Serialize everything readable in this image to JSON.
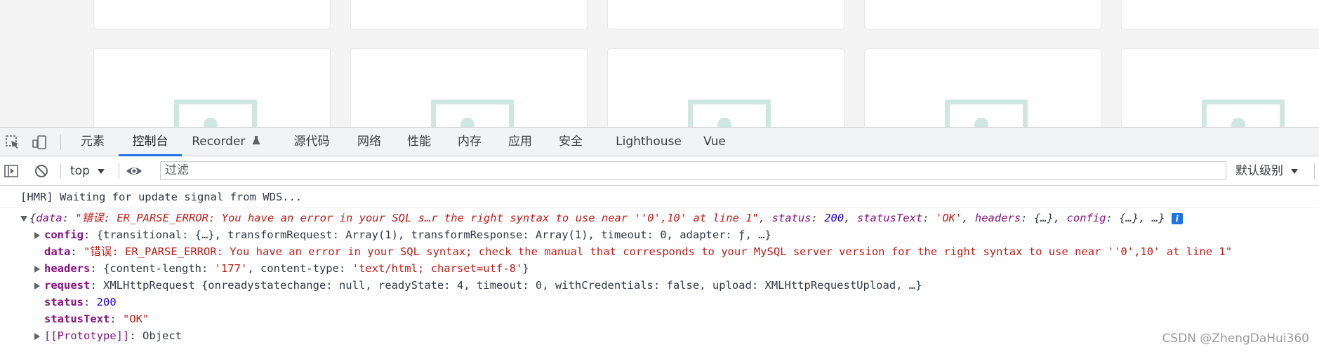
{
  "tabs": {
    "elements": "元素",
    "console": "控制台",
    "recorder": "Recorder",
    "sources": "源代码",
    "network": "网络",
    "performance": "性能",
    "memory": "内存",
    "application": "应用",
    "security": "安全",
    "lighthouse": "Lighthouse",
    "vue": "Vue"
  },
  "toolbar": {
    "context": "top",
    "filter_placeholder": "过滤",
    "levels": "默认级别"
  },
  "console": {
    "hmr": "[HMR] Waiting for update signal from WDS...",
    "summary": {
      "open": "{",
      "data_key": "data",
      "data_val": "\"错误: ER_PARSE_ERROR: You have an error in your SQL s…r the right syntax to use near ''0',10' at line 1\"",
      "status_key": "status",
      "status_val": "200",
      "statusText_key": "statusText",
      "statusText_val": "'OK'",
      "headers_key": "headers",
      "headers_val": "{…}",
      "config_key": "config",
      "config_val": "{…}",
      "tail": ", …}"
    },
    "config": {
      "key": "config",
      "text": "{transitional: {…}, transformRequest: Array(1), transformResponse: Array(1), timeout: 0, adapter: ƒ, …}"
    },
    "data": {
      "key": "data",
      "val": "\"错误: ER_PARSE_ERROR: You have an error in your SQL syntax; check the manual that corresponds to your MySQL server version for the right syntax to use near ''0',10' at line 1\""
    },
    "headers": {
      "key": "headers",
      "text_open": "{content-length: ",
      "cl_val": "'177'",
      "mid": ", content-type: ",
      "ct_val": "'text/html; charset=utf-8'",
      "close": "}"
    },
    "request": {
      "key": "request",
      "text": "XMLHttpRequest {onreadystatechange: null, readyState: 4, timeout: 0, withCredentials: false, upload: XMLHttpRequestUpload, …}"
    },
    "status": {
      "key": "status",
      "val": "200"
    },
    "statusText": {
      "key": "statusText",
      "val": "\"OK\""
    },
    "prototype": {
      "key": "[[Prototype]]",
      "val": "Object"
    }
  },
  "watermark": "CSDN @ZhengDaHui360",
  "colors": {
    "accent": "#1a73e8",
    "string": "#c41a16",
    "number": "#1c00cf",
    "key": "#881280"
  }
}
